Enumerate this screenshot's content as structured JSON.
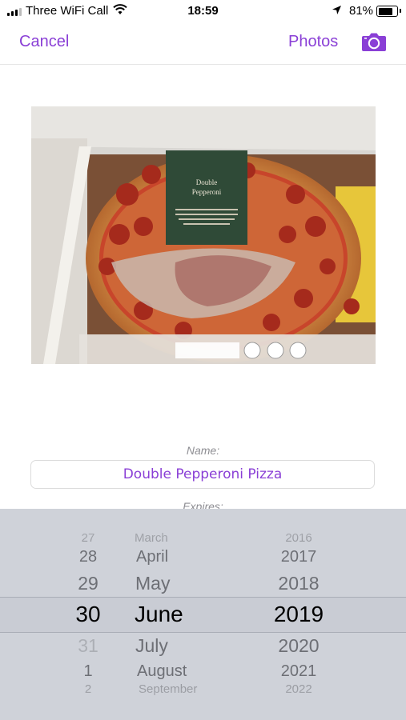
{
  "status_bar": {
    "carrier": "Three WiFi Call",
    "time": "18:59",
    "battery": "81%"
  },
  "nav": {
    "cancel_label": "Cancel",
    "photos_label": "Photos",
    "camera_icon": "camera-icon"
  },
  "photo": {
    "icon": "pizza-photo"
  },
  "form": {
    "name_label": "Name:",
    "name_value": "Double Pepperoni Pizza",
    "expires_label": "Expires:"
  },
  "picker": {
    "days": [
      "27",
      "28",
      "29",
      "30",
      "31",
      "1",
      "2"
    ],
    "months": [
      "March",
      "April",
      "May",
      "June",
      "July",
      "August",
      "September"
    ],
    "years": [
      "2016",
      "2017",
      "2018",
      "2019",
      "2020",
      "2021",
      "2022"
    ],
    "selected_day": "30",
    "selected_month": "June",
    "selected_year": "2019"
  },
  "colors": {
    "accent": "#8a3fd6",
    "picker_bg": "#cfd2d9"
  }
}
